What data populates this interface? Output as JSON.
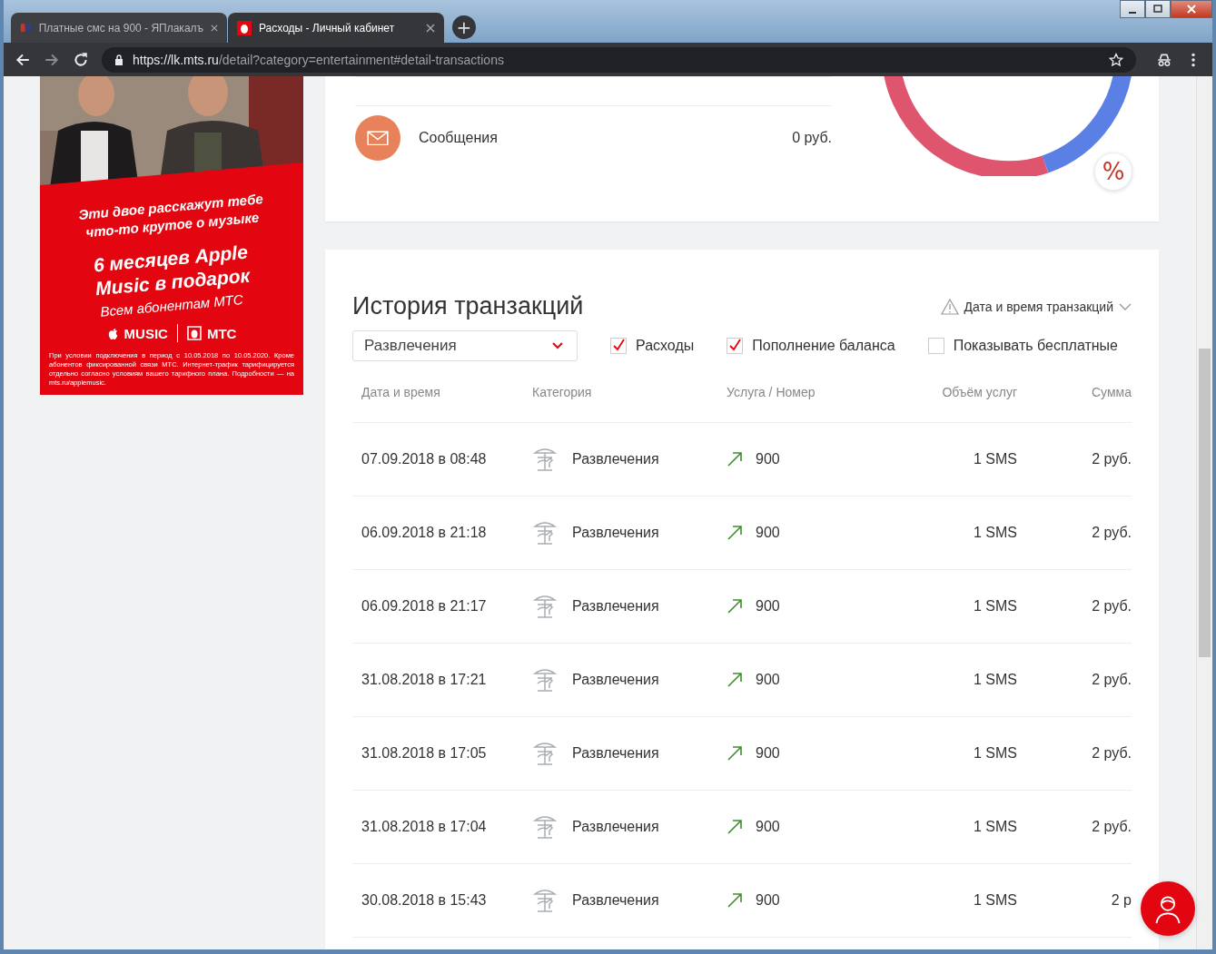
{
  "browser": {
    "tabs": [
      {
        "title": "Платные смс на 900 - ЯПлакалъ",
        "selected": false
      },
      {
        "title": "Расходы - Личный кабинет",
        "selected": true
      }
    ],
    "new_tab": "+",
    "url_host": "https://lk.mts.ru",
    "url_path": "/detail?category=entertainment#detail-transactions"
  },
  "ad": {
    "headline": "Эти двое расскажут тебе что-то крутое о музыке",
    "offer": "6 месяцев Apple Music в подарок",
    "audience": "Всем абонентам МТС",
    "brand_music": "MUSIC",
    "brand_operator": "МТС",
    "fine_print": "При условии подключения в период с 10.05.2018 по 10.05.2020. Кроме абонентов фиксированной связи МТС. Интернет-трафик тарифицируется отдельно согласно условиям вашего тарифного плана. Подробности — на mts.ru/applemusic."
  },
  "categories": [
    {
      "name": "Сообщения",
      "amount": "0 руб.",
      "color": "#e8825a"
    }
  ],
  "percent_button": "%",
  "history": {
    "title": "История транзакций",
    "sort": "Дата и время транзакций",
    "category_select": "Развлечения",
    "filters": [
      {
        "label": "Расходы",
        "checked": true
      },
      {
        "label": "Пополнение баланса",
        "checked": true
      },
      {
        "label": "Показывать бесплатные",
        "checked": false
      }
    ],
    "columns": [
      "Дата и время",
      "Категория",
      "Услуга / Номер",
      "Объём услуг",
      "Сумма"
    ],
    "rows": [
      {
        "date": "07.09.2018 в 08:48",
        "category": "Развлечения",
        "number": "900",
        "volume": "1 SMS",
        "sum": "2 руб."
      },
      {
        "date": "06.09.2018 в 21:18",
        "category": "Развлечения",
        "number": "900",
        "volume": "1 SMS",
        "sum": "2 руб."
      },
      {
        "date": "06.09.2018 в 21:17",
        "category": "Развлечения",
        "number": "900",
        "volume": "1 SMS",
        "sum": "2 руб."
      },
      {
        "date": "31.08.2018 в 17:21",
        "category": "Развлечения",
        "number": "900",
        "volume": "1 SMS",
        "sum": "2 руб."
      },
      {
        "date": "31.08.2018 в 17:05",
        "category": "Развлечения",
        "number": "900",
        "volume": "1 SMS",
        "sum": "2 руб."
      },
      {
        "date": "31.08.2018 в 17:04",
        "category": "Развлечения",
        "number": "900",
        "volume": "1 SMS",
        "sum": "2 руб."
      },
      {
        "date": "30.08.2018 в 15:43",
        "category": "Развлечения",
        "number": "900",
        "volume": "1 SMS",
        "sum": "2 р"
      }
    ]
  }
}
